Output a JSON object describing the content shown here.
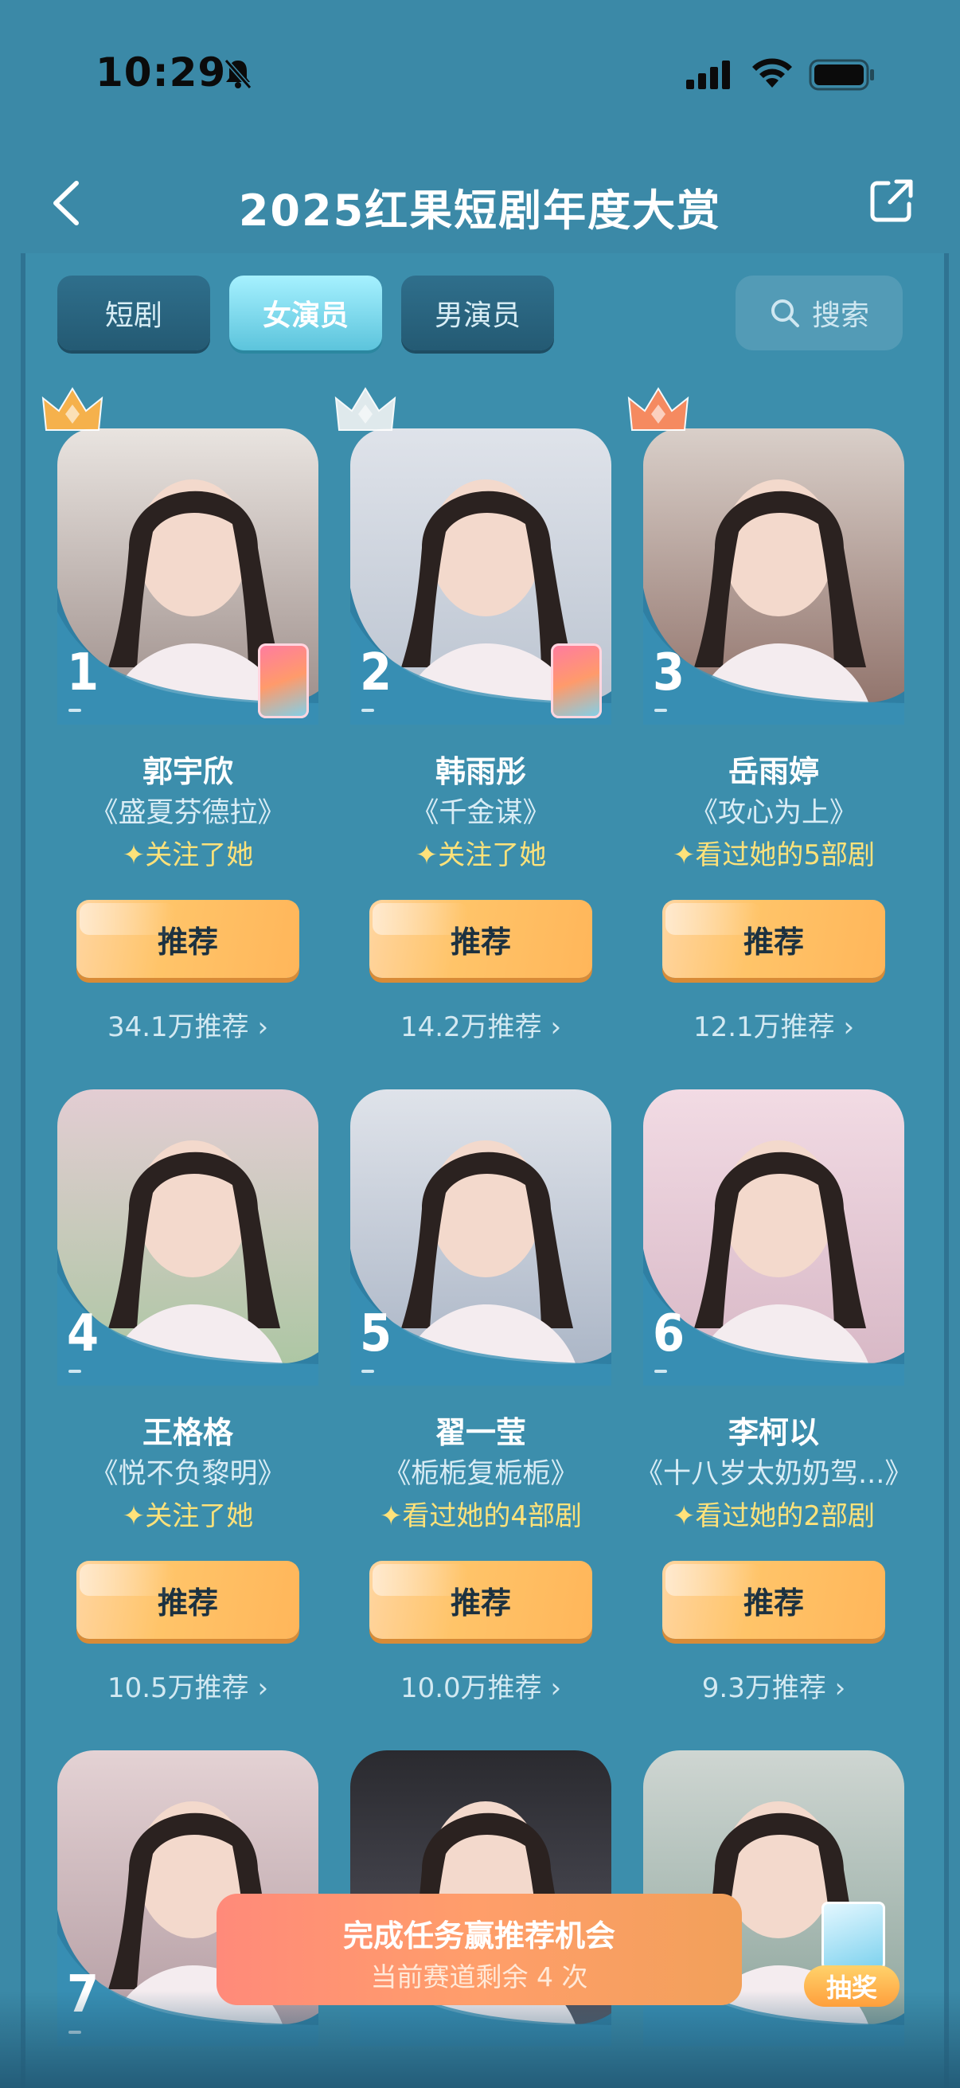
{
  "status": {
    "time": "10:29"
  },
  "header": {
    "title": "2025红果短剧年度大赏"
  },
  "tabs": [
    {
      "label": "短剧",
      "active": false
    },
    {
      "label": "女演员",
      "active": true
    },
    {
      "label": "男演员",
      "active": false
    }
  ],
  "search": {
    "label": "搜索"
  },
  "recommend_label": "推荐",
  "actresses": [
    {
      "rank": "1",
      "name": "郭宇欣",
      "drama": "《盛夏芬德拉》",
      "note": "✦关注了她",
      "count": "34.1万推荐 ›"
    },
    {
      "rank": "2",
      "name": "韩雨彤",
      "drama": "《千金谋》",
      "note": "✦关注了她",
      "count": "14.2万推荐 ›"
    },
    {
      "rank": "3",
      "name": "岳雨婷",
      "drama": "《攻心为上》",
      "note": "✦看过她的5部剧",
      "count": "12.1万推荐 ›"
    },
    {
      "rank": "4",
      "name": "王格格",
      "drama": "《悦不负黎明》",
      "note": "✦关注了她",
      "count": "10.5万推荐 ›"
    },
    {
      "rank": "5",
      "name": "翟一莹",
      "drama": "《栀栀复栀栀》",
      "note": "✦看过她的4部剧",
      "count": "10.0万推荐 ›"
    },
    {
      "rank": "6",
      "name": "李柯以",
      "drama": "《十八岁太奶奶驾...》",
      "note": "✦看过她的2部剧",
      "count": "9.3万推荐 ›"
    },
    {
      "rank": "7"
    },
    {
      "rank": ""
    },
    {
      "rank": ""
    }
  ],
  "task": {
    "title": "完成任务赢推荐机会",
    "subtitle": "当前赛道剩余 4 次"
  },
  "lottery": {
    "label": "抽奖"
  },
  "colors": {
    "background": "#3b89a7",
    "accent_button": "#ffc469",
    "highlight_text": "#ffe27a"
  }
}
